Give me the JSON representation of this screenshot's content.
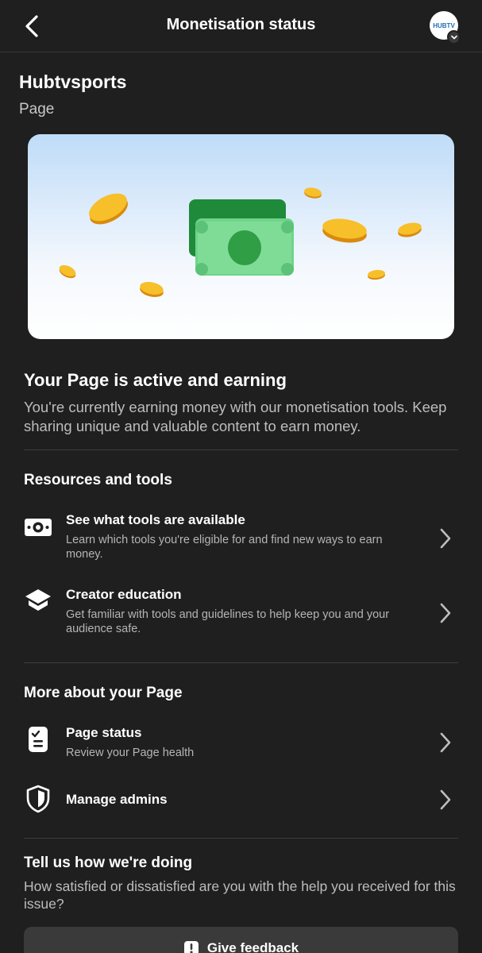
{
  "header": {
    "title": "Monetisation status",
    "avatar_text": "HUBTV"
  },
  "page": {
    "name": "Hubtvsports",
    "type": "Page"
  },
  "status": {
    "title": "Your Page is active and earning",
    "description": "You're currently earning money with our monetisation tools. Keep sharing unique and valuable content to earn money."
  },
  "resources": {
    "title": "Resources and tools",
    "items": [
      {
        "title": "See what tools are available",
        "subtitle": "Learn which tools you're eligible for and find new ways to earn money.",
        "icon": "money-icon"
      },
      {
        "title": "Creator education",
        "subtitle": "Get familiar with tools and guidelines to help keep you and your audience safe.",
        "icon": "graduation-cap-icon"
      }
    ]
  },
  "more": {
    "title": "More about your Page",
    "items": [
      {
        "title": "Page status",
        "subtitle": "Review your Page health",
        "icon": "clipboard-check-icon"
      },
      {
        "title": "Manage admins",
        "subtitle": "",
        "icon": "shield-icon"
      }
    ]
  },
  "feedback": {
    "title": "Tell us how we're doing",
    "description": "How satisfied or dissatisfied are you with the help you received for this issue?",
    "button_label": "Give feedback",
    "button_icon": "alert-icon"
  },
  "colors": {
    "background": "#1f1f1f",
    "divider": "#3d3d3d",
    "secondary_text": "#b5b5b5",
    "money_green": "#2f9e44",
    "coin_gold": "#f5b81c"
  }
}
